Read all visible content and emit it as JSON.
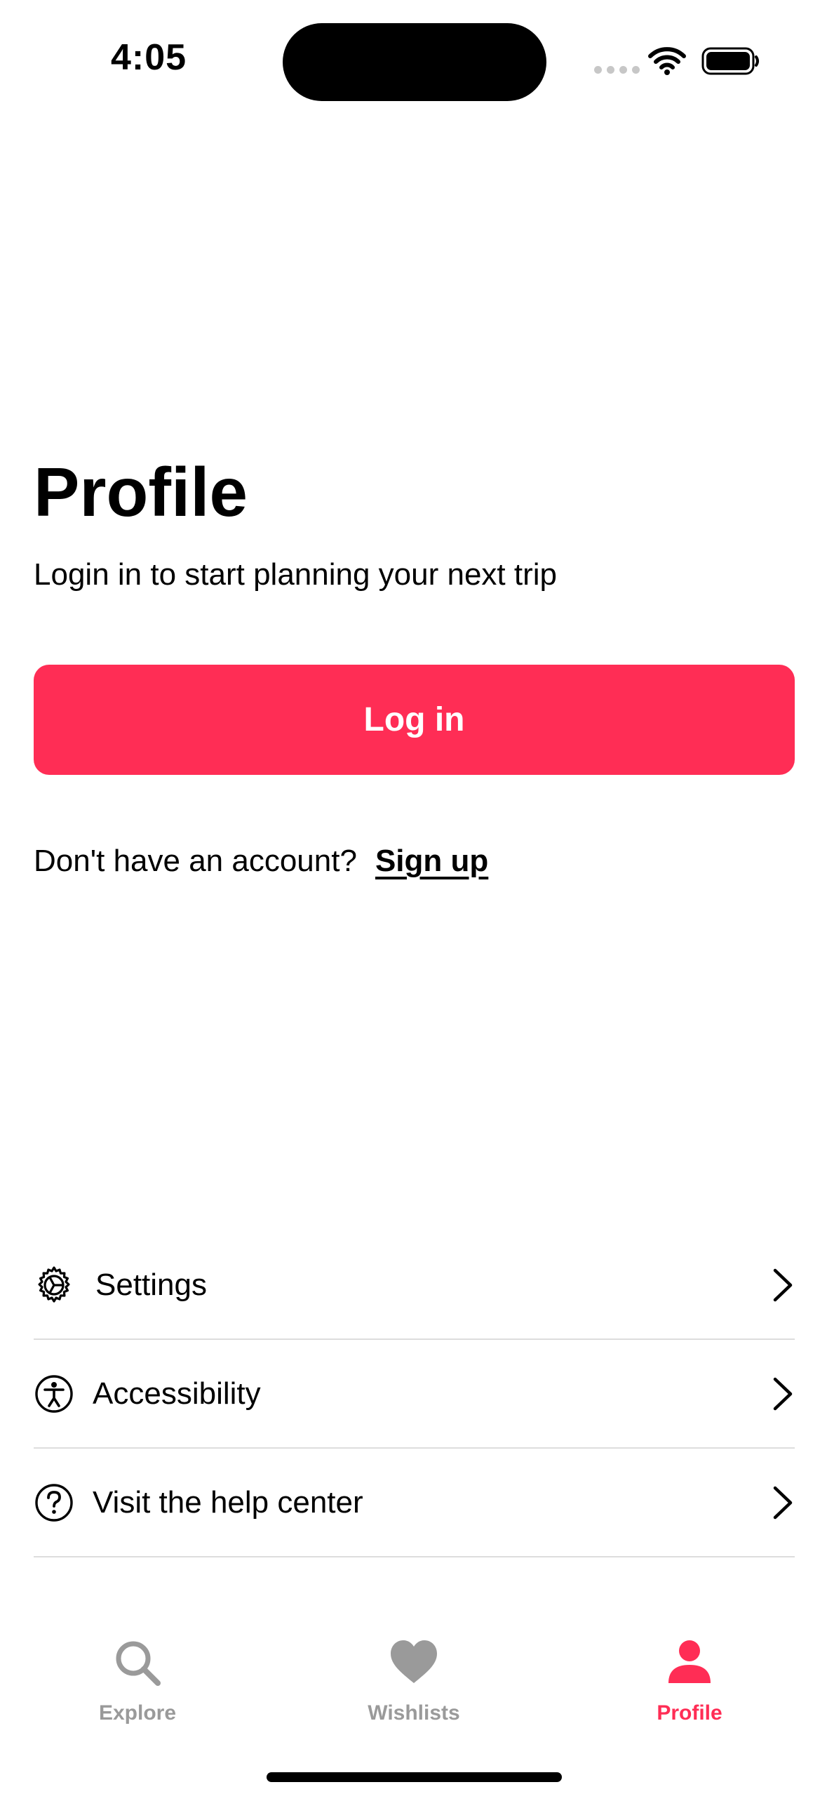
{
  "status_bar": {
    "time": "4:05"
  },
  "main": {
    "title": "Profile",
    "subtitle": "Login in to start planning your next trip",
    "login_button_label": "Log in",
    "signup_prompt": "Don't have an account?",
    "signup_link": "Sign up"
  },
  "menu": {
    "items": [
      {
        "label": "Settings",
        "icon": "gear-icon"
      },
      {
        "label": "Accessibility",
        "icon": "accessibility-icon"
      },
      {
        "label": "Visit the help center",
        "icon": "question-circle-icon"
      }
    ]
  },
  "tab_bar": {
    "tabs": [
      {
        "label": "Explore",
        "icon": "search-icon",
        "active": false
      },
      {
        "label": "Wishlists",
        "icon": "heart-icon",
        "active": false
      },
      {
        "label": "Profile",
        "icon": "person-icon",
        "active": true
      }
    ]
  },
  "colors": {
    "accent": "#ff2d55",
    "inactive": "#9a9a9a",
    "divider": "#dddddd"
  }
}
